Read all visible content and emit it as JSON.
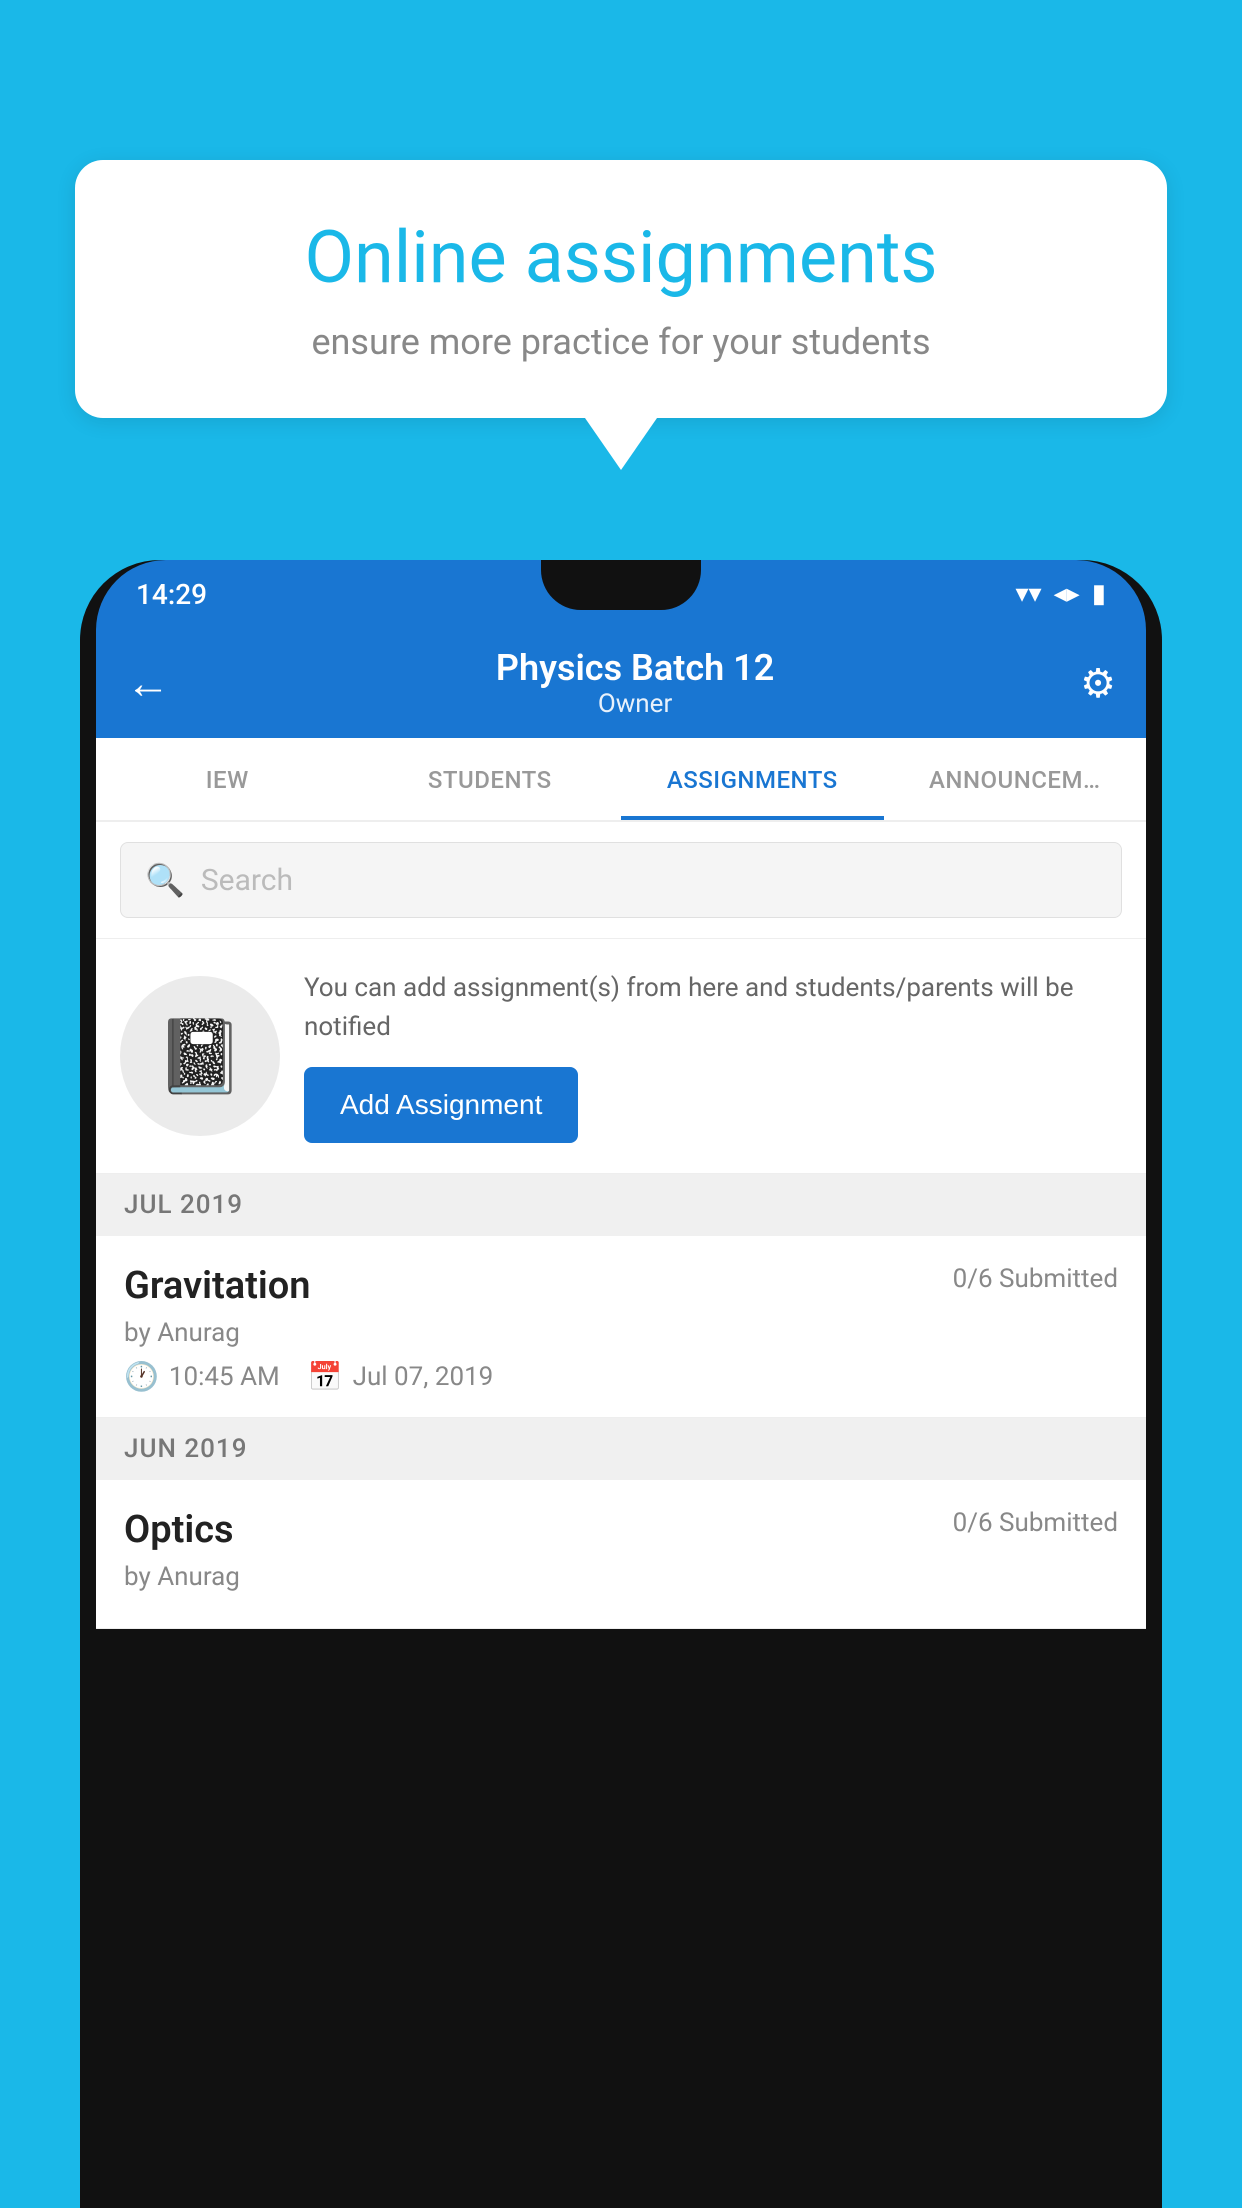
{
  "background_color": "#1ab8e8",
  "speech_bubble": {
    "title": "Online assignments",
    "subtitle": "ensure more practice for your students"
  },
  "status_bar": {
    "time": "14:29",
    "wifi_icon": "▼",
    "signal_icon": "▲",
    "battery_icon": "▮"
  },
  "header": {
    "title": "Physics Batch 12",
    "subtitle": "Owner",
    "back_label": "←",
    "settings_label": "⚙"
  },
  "tabs": [
    {
      "label": "IEW",
      "active": false
    },
    {
      "label": "STUDENTS",
      "active": false
    },
    {
      "label": "ASSIGNMENTS",
      "active": true
    },
    {
      "label": "ANNOUNCEM…",
      "active": false
    }
  ],
  "search": {
    "placeholder": "Search"
  },
  "promo": {
    "description": "You can add assignment(s) from here and students/parents will be notified",
    "button_label": "Add Assignment"
  },
  "months": [
    {
      "label": "JUL 2019",
      "assignments": [
        {
          "name": "Gravitation",
          "submitted": "0/6 Submitted",
          "by": "by Anurag",
          "time": "10:45 AM",
          "date": "Jul 07, 2019"
        }
      ]
    },
    {
      "label": "JUN 2019",
      "assignments": [
        {
          "name": "Optics",
          "submitted": "0/6 Submitted",
          "by": "by Anurag",
          "time": "",
          "date": ""
        }
      ]
    }
  ]
}
